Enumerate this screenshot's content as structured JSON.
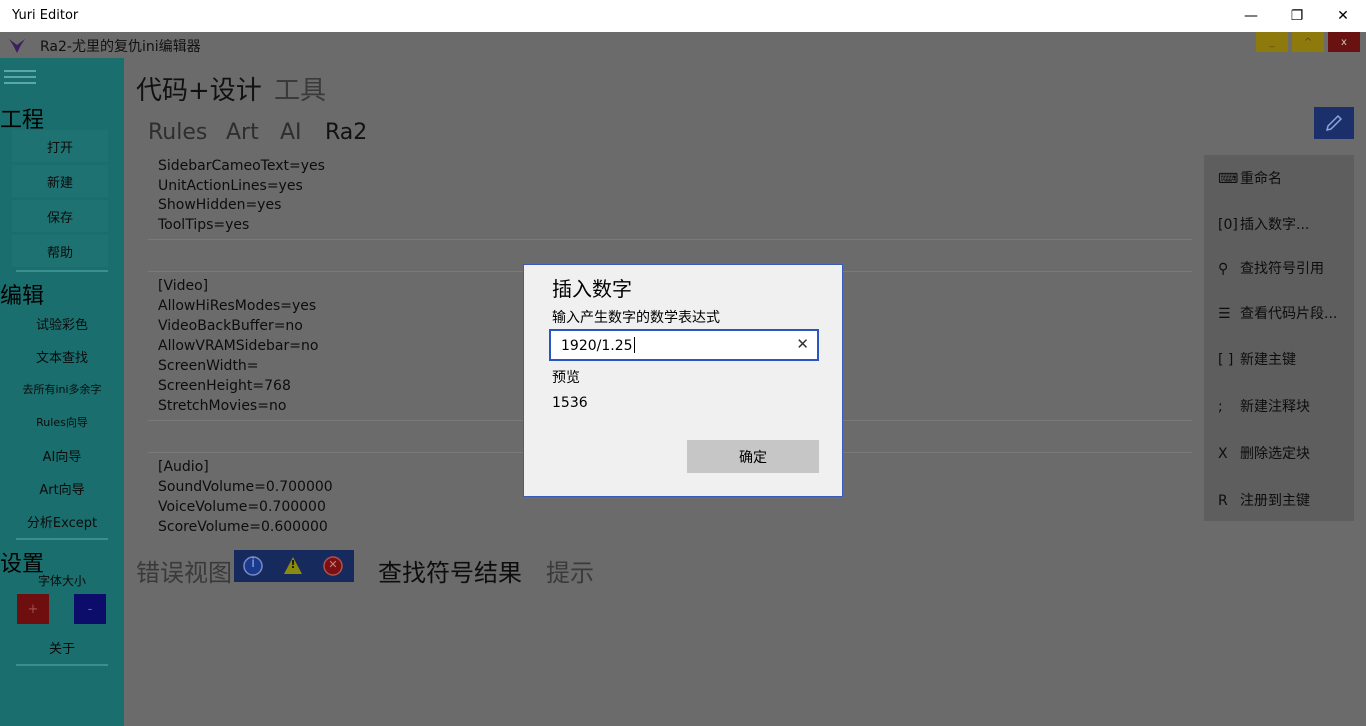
{
  "window": {
    "title": "Yuri Editor",
    "min_glyph": "—",
    "max_glyph": "❐",
    "close_glyph": "✕"
  },
  "app": {
    "title": "Ra2-尤里的复仇ini编辑器",
    "ctrl_minimize": "_",
    "ctrl_maximize": "^",
    "ctrl_close": "x"
  },
  "sidebar": {
    "sections": {
      "project": "工程",
      "edit": "编辑",
      "settings": "设置"
    },
    "project_buttons": [
      "打开",
      "新建",
      "保存",
      "帮助"
    ],
    "edit_items": [
      "试验彩色",
      "文本查找",
      "去所有ini多余字",
      "Rules向导",
      "AI向导",
      "Art向导",
      "分析Except"
    ],
    "font_size_label": "字体大小",
    "font_plus": "+",
    "font_minus": "-",
    "about": "关于"
  },
  "main_tabs": [
    "代码+设计",
    "工具"
  ],
  "sub_tabs": [
    "Rules",
    "Art",
    "AI",
    "Ra2"
  ],
  "code": {
    "block1": [
      "SidebarCameoText=yes",
      "UnitActionLines=yes",
      "ShowHidden=yes",
      "ToolTips=yes"
    ],
    "block2": [
      "[Video]",
      "AllowHiResModes=yes",
      "VideoBackBuffer=no",
      "AllowVRAMSidebar=no",
      "ScreenWidth=",
      "ScreenHeight=768",
      "StretchMovies=no"
    ],
    "block3": [
      "[Audio]",
      "SoundVolume=0.700000",
      "VoiceVolume=0.700000",
      "ScoreVolume=0.600000"
    ]
  },
  "tools": [
    {
      "icon": "⌨",
      "label": "重命名"
    },
    {
      "icon": "[0]",
      "label": "插入数字..."
    },
    {
      "icon": "⚲",
      "label": "查找符号引用"
    },
    {
      "icon": "☰",
      "label": "查看代码片段..."
    },
    {
      "icon": "[ ]",
      "label": "新建主键"
    },
    {
      "icon": ";",
      "label": "新建注释块"
    },
    {
      "icon": "X",
      "label": "删除选定块"
    },
    {
      "icon": "R",
      "label": "注册到主键"
    }
  ],
  "bottom_tabs": [
    "错误视图",
    "查找符号结果",
    "提示"
  ],
  "filter_icons": {
    "info": "i",
    "warning": "!",
    "error": "✕"
  },
  "dialog": {
    "title": "插入数字",
    "label": "输入产生数字的数学表达式",
    "input_value": "1920/1.25",
    "clear_glyph": "✕",
    "preview_label": "预览",
    "preview_value": "1536",
    "ok_label": "确定"
  },
  "colors": {
    "sidebar": "#1a6e6e",
    "overlay_bg": "#6b6b6b",
    "dialog_border": "#3a5cb8",
    "accent_blue": "#2a56c4"
  }
}
